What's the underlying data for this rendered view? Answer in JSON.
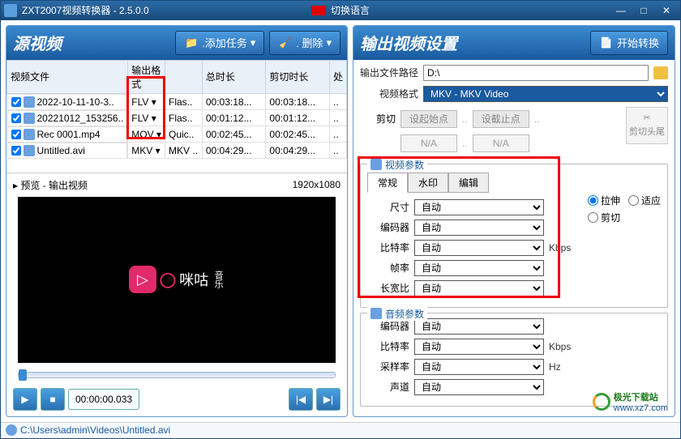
{
  "title": "ZXT2007视频转换器 - 2.5.0.0",
  "lang_switch": "切换语言",
  "source_title": "源视频",
  "add_task_label": ".添加任务",
  "delete_label": ". 删除",
  "columns": {
    "file": "视频文件",
    "fmt": "输出格式",
    "dur": "总时长",
    "cut": "剪切时长",
    "proc": "处"
  },
  "files": [
    {
      "name": "2022-10-11-10-3..",
      "fmt": "FLV",
      "codec": "Flas..",
      "dur": "00:03:18...",
      "cut": "00:03:18..."
    },
    {
      "name": "20221012_153256..",
      "fmt": "FLV",
      "codec": "Flas..",
      "dur": "00:01:12...",
      "cut": "00:01:12..."
    },
    {
      "name": "Rec 0001.mp4",
      "fmt": "MOV",
      "codec": "Quic..",
      "dur": "00:02:45...",
      "cut": "00:02:45..."
    },
    {
      "name": "Untitled.avi",
      "fmt": "MKV",
      "codec": "MKV ..",
      "dur": "00:04:29...",
      "cut": "00:04:29..."
    }
  ],
  "preview_label": "▸ 预览 - 输出视频",
  "preview_dim": "1920x1080",
  "preview_logo_text": "咪咕",
  "preview_logo_sub": "音乐",
  "timecode": "00:00:00.033",
  "status_path": "C:\\Users\\admin\\Videos\\Untitled.avi",
  "output_title": "输出视频设置",
  "start_convert": "开始转换",
  "out_path_label": "输出文件路径",
  "out_path_value": "D:\\",
  "video_format_label": "视频格式",
  "video_format_value": "MKV - MKV Video",
  "cut_label": "剪切",
  "set_start": "设起始点",
  "set_end": "设截止点",
  "cut_na": "N/A",
  "cut_tail": "剪切头尾",
  "video_params_legend": "视频参数",
  "tabs": {
    "general": "常规",
    "watermark": "水印",
    "edit": "编辑"
  },
  "params": {
    "size": "尺寸",
    "encoder": "编码器",
    "bitrate": "比特率",
    "fps": "帧率",
    "aspect": "长宽比",
    "auto": "自动",
    "kbps": "Kbps"
  },
  "fit_opts": {
    "stretch": "拉伸",
    "fit": "适应",
    "crop": "剪切"
  },
  "audio_params_legend": "音频参数",
  "audio": {
    "encoder": "编码器",
    "bitrate": "比特率",
    "sample": "采样率",
    "channel": "声道",
    "auto": "自动",
    "kbps": "Kbps",
    "hz": "Hz"
  },
  "watermark_site": {
    "name": "极光下载站",
    "url": "www.xz7.com"
  }
}
